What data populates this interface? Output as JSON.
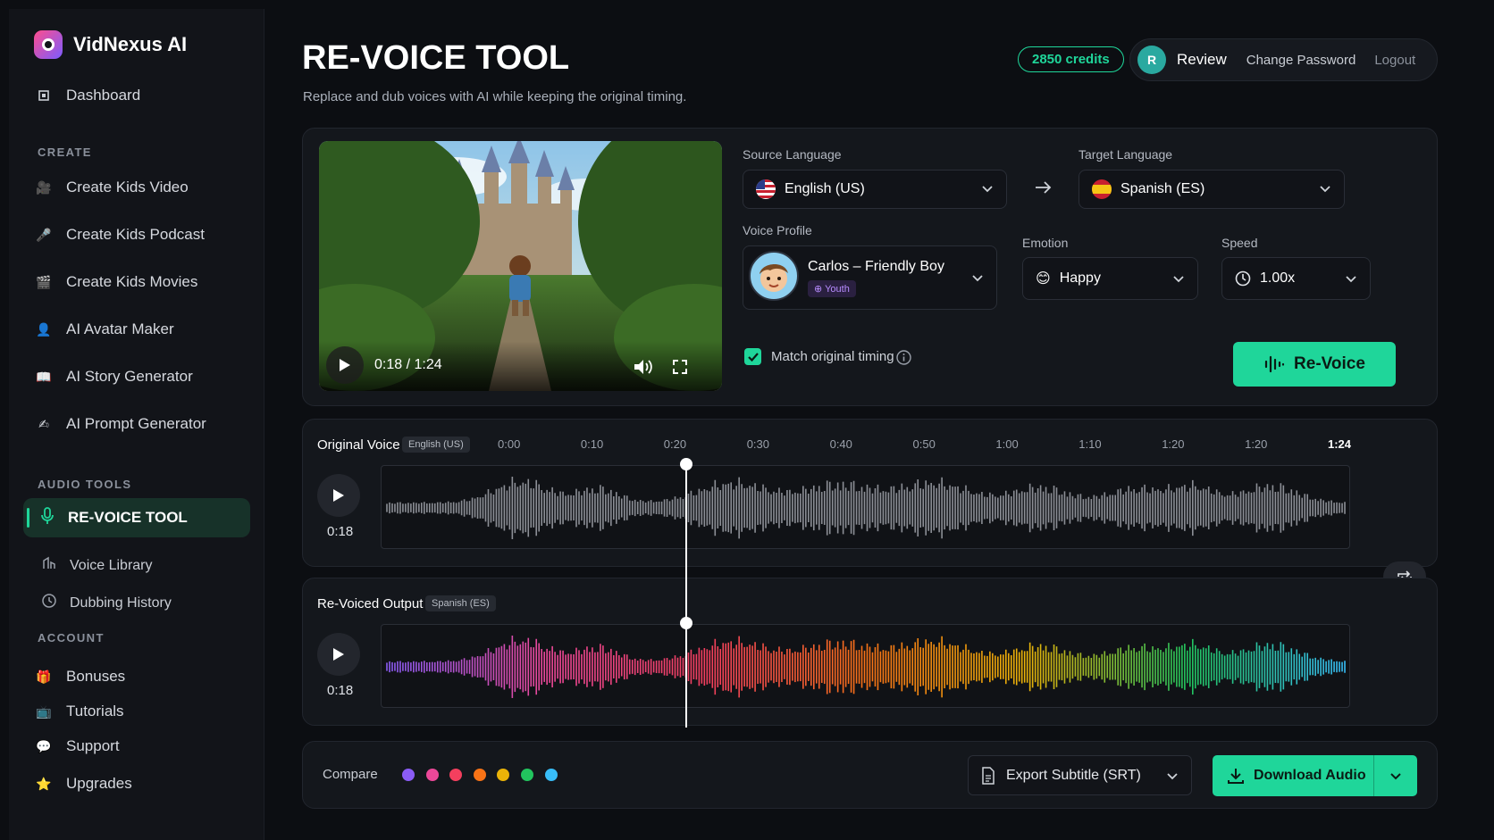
{
  "brand": {
    "name": "VidNexus AI"
  },
  "sidebar": {
    "dashboard": "Dashboard",
    "create_label": "CREATE",
    "create_items": [
      "Create Kids Video",
      "Create Kids Podcast",
      "Create Kids Movies",
      "AI Avatar Maker",
      "AI Story Generator",
      "AI Prompt Generator"
    ],
    "audio_label": "AUDIO TOOLS",
    "audio_active": "RE-VOICE TOOL",
    "audio_items": [
      "Voice Library",
      "Dubbing History"
    ],
    "account_label": "ACCOUNT",
    "account_items": [
      "Bonuses",
      "Tutorials",
      "Support",
      "Upgrades"
    ]
  },
  "header": {
    "title": "RE-VOICE TOOL",
    "subtitle": "Replace and dub voices with AI while keeping the original timing.",
    "credits": "2850 credits",
    "avatar_letter": "R",
    "user": "Review",
    "change_password": "Change Password",
    "logout": "Logout"
  },
  "video": {
    "time": "0:18 / 1:24"
  },
  "settings": {
    "source_label": "Source Language",
    "source_value": "English (US)",
    "target_label": "Target Language",
    "target_value": "Spanish (ES)",
    "voice_label": "Voice Profile",
    "voice_name": "Carlos – Friendly Boy",
    "voice_tag": "Youth",
    "emotion_label": "Emotion",
    "emotion_value": "Happy",
    "speed_label": "Speed",
    "speed_value": "1.00x",
    "match_timing": "Match original timing",
    "match_timing_checked": true,
    "revoice_button": "Re-Voice"
  },
  "timeline": {
    "ticks": [
      "0:00",
      "0:10",
      "0:20",
      "0:30",
      "0:40",
      "0:50",
      "1:00",
      "1:10",
      "1:20",
      "1:20",
      "1:24"
    ],
    "playhead_fraction": 0.2917
  },
  "tracks": {
    "original_label": "Original Voice",
    "original_lang": "English (US)",
    "original_time": "0:18",
    "output_label": "Re-Voiced Output",
    "output_lang": "Spanish (ES)",
    "output_time": "0:18"
  },
  "footer": {
    "compare_label": "Compare",
    "compare_colors": [
      "#8b5cf6",
      "#ec4899",
      "#f43f5e",
      "#f97316",
      "#eab308",
      "#22c55e",
      "#38bdf8"
    ],
    "export_label": "Export Subtitle (SRT)",
    "download_label": "Download Audio"
  },
  "colors": {
    "accent": "#1fd69a",
    "background": "#0c0e12",
    "panel": "#14171c"
  }
}
